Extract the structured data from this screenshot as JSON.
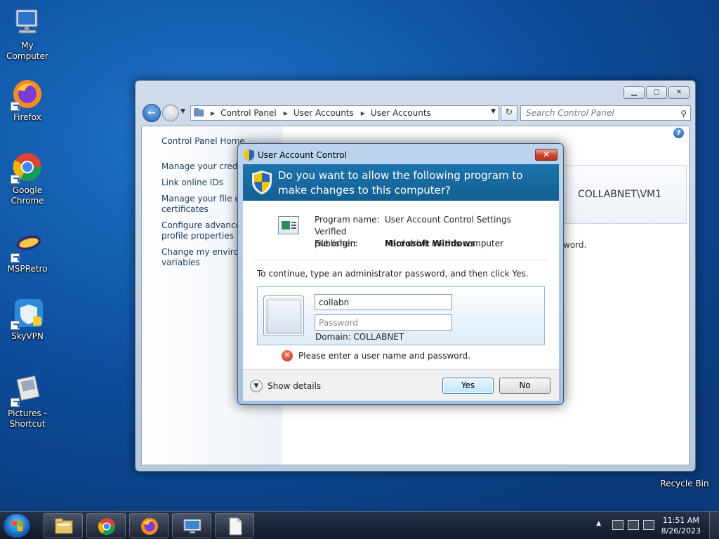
{
  "desktop": {
    "icons": [
      {
        "label": "My Computer"
      },
      {
        "label": "Firefox"
      },
      {
        "label": "Google Chrome"
      },
      {
        "label": "MSPRetro"
      },
      {
        "label": "SkyVPN"
      },
      {
        "label": "Pictures - Shortcut"
      },
      {
        "label": "Recycle Bin"
      }
    ]
  },
  "control_panel": {
    "breadcrumb": [
      "Control Panel",
      "User Accounts",
      "User Accounts"
    ],
    "search_placeholder": "Search Control Panel",
    "left_links": [
      "Control Panel Home",
      "Manage your credentials",
      "Link online IDs",
      "Manage your file encryption certificates",
      "Configure advanced user profile properties",
      "Change my environment variables"
    ],
    "left_links_visible": [
      "Control Panel Home",
      "Manage your creden",
      "Link online IDs",
      "Manage your file enc",
      "certificates",
      "Configure advanced",
      "profile properties",
      "Change my environm",
      "variables"
    ],
    "user_name": "COLLABNET\\VM1",
    "partial_text": "word."
  },
  "uac": {
    "title": "User Account Control",
    "question": "Do you want to allow the following program to make changes to this computer?",
    "program_name_label": "Program name:",
    "program_name": "User Account Control Settings",
    "publisher_label": "Verified publisher:",
    "publisher": "Microsoft Windows",
    "origin_label": "File origin:",
    "origin": "Hard drive on this computer",
    "instruction": "To continue, type an administrator password, and then click Yes.",
    "username_value": "collabn",
    "password_placeholder": "Password",
    "domain": "Domain: COLLABNET",
    "error": "Please enter a user name and password.",
    "show_details": "Show details",
    "yes": "Yes",
    "no": "No",
    "close_glyph": "✕",
    "banner_color": "#1c74ab"
  },
  "taskbar": {
    "pinned": [
      "windows-explorer",
      "google-chrome",
      "firefox",
      "remote-desktop",
      "notepad"
    ],
    "clock_time": "11:51 AM",
    "clock_date": "8/26/2023"
  }
}
